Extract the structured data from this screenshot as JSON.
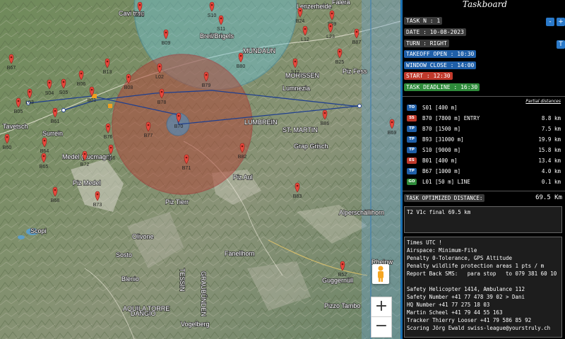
{
  "map": {
    "places": [
      {
        "id": "chur",
        "text": "Cavi trau"
      },
      {
        "id": "breil",
        "text": "Breil/Brigels"
      },
      {
        "id": "lenzerheide",
        "text": "Lenzerheide"
      },
      {
        "id": "falera",
        "text": "Falera"
      },
      {
        "id": "mundaun",
        "text": "MUNDAUN"
      },
      {
        "id": "morissen",
        "text": "MORISSEN"
      },
      {
        "id": "lumnezia",
        "text": "Lumnezia"
      },
      {
        "id": "pizfess",
        "text": "Piz Fess"
      },
      {
        "id": "stmartin",
        "text": "ST. MARTIN"
      },
      {
        "id": "grapgrisch",
        "text": "Grap Grisch"
      },
      {
        "id": "medel",
        "text": "Medel (Lucmagn)"
      },
      {
        "id": "pizmedel",
        "text": "Piz Medel"
      },
      {
        "id": "pizaul",
        "text": "Piz Aul"
      },
      {
        "id": "piztierr",
        "text": "Piz Tierr"
      },
      {
        "id": "alperschall",
        "text": "Alperschällihorn"
      },
      {
        "id": "scopi",
        "text": "Scopi"
      },
      {
        "id": "sosto",
        "text": "Sosto"
      },
      {
        "id": "fanellhorn",
        "text": "Fanellhorn"
      },
      {
        "id": "tessin",
        "text": "TESSIN"
      },
      {
        "id": "graubunden",
        "text": "GRAUBÜNDEN"
      },
      {
        "id": "guggernull",
        "text": "Guggernüll"
      },
      {
        "id": "pizzotambo",
        "text": "Pizzo Tambo"
      },
      {
        "id": "vogelberg",
        "text": "Vogelberg"
      },
      {
        "id": "rheinwald",
        "text": "Rheinw"
      },
      {
        "id": "cavel",
        "text": "Tavetsch"
      },
      {
        "id": "lumbrein",
        "text": "LUMBREIN"
      },
      {
        "id": "surrein",
        "text": "Surrein"
      },
      {
        "id": "olivone",
        "text": "Olivone"
      },
      {
        "id": "blenio",
        "text": "Blenio"
      },
      {
        "id": "aquila",
        "text": "AQUILA TORRE"
      },
      {
        "id": "dangio",
        "text": "DANGIO"
      }
    ],
    "waypoints": [
      {
        "id": "B10",
        "label": "B10"
      },
      {
        "id": "S11",
        "label": "S11"
      },
      {
        "id": "S10",
        "label": "S10"
      },
      {
        "id": "B24",
        "label": "B24"
      },
      {
        "id": "S09",
        "label": "S09"
      },
      {
        "id": "L12",
        "label": "L12"
      },
      {
        "id": "L23",
        "label": "L23"
      },
      {
        "id": "B87",
        "label": "B87"
      },
      {
        "id": "B09",
        "label": "B09"
      },
      {
        "id": "B80",
        "label": "B80"
      },
      {
        "id": "S12",
        "label": "S12"
      },
      {
        "id": "B25",
        "label": "B25"
      },
      {
        "id": "B67",
        "label": "B67"
      },
      {
        "id": "B13",
        "label": "B13"
      },
      {
        "id": "L02",
        "label": "L02"
      },
      {
        "id": "B08",
        "label": "B08"
      },
      {
        "id": "B79",
        "label": "B79"
      },
      {
        "id": "B78",
        "label": "B78"
      },
      {
        "id": "S04",
        "label": "S04"
      },
      {
        "id": "S05",
        "label": "S05"
      },
      {
        "id": "B06",
        "label": "B06"
      },
      {
        "id": "B01",
        "label": "B01"
      },
      {
        "id": "L03",
        "label": "L03"
      },
      {
        "id": "B05",
        "label": "B05"
      },
      {
        "id": "B61",
        "label": "B61"
      },
      {
        "id": "B70",
        "label": "B70"
      },
      {
        "id": "B77",
        "label": "B77"
      },
      {
        "id": "B76",
        "label": "B76"
      },
      {
        "id": "B86",
        "label": "B86"
      },
      {
        "id": "B82",
        "label": "B82"
      },
      {
        "id": "B71",
        "label": "B71"
      },
      {
        "id": "B64",
        "label": "B64"
      },
      {
        "id": "B65",
        "label": "B65"
      },
      {
        "id": "B72",
        "label": "B72"
      },
      {
        "id": "B66",
        "label": "B66"
      },
      {
        "id": "B68",
        "label": "B68"
      },
      {
        "id": "B73",
        "label": "B73"
      },
      {
        "id": "B83",
        "label": "B83"
      },
      {
        "id": "B52",
        "label": "B52"
      },
      {
        "id": "B60",
        "label": "B60"
      },
      {
        "id": "B69",
        "label": "B69"
      }
    ],
    "zoom_in": "+",
    "zoom_out": "−"
  },
  "panel": {
    "title": "Taskboard",
    "task": "TASK N : 1",
    "date": "DATE : 10-08-2023",
    "turn": "TURN : RIGHT",
    "takeoff": "TAKEOFF OPEN : 10:30",
    "window_close": "WINDOW CLOSE : 14:00",
    "start": "START : 12:30",
    "deadline": "TASK DEADLINE : 16:30",
    "btn_minus": "-",
    "btn_plus": "+",
    "btn_t": "T",
    "partial_label": "Partial distances",
    "turnpoints": [
      {
        "type": "TO",
        "color": "#1f5fa8",
        "desc": "S01 [400 m]",
        "dist": ""
      },
      {
        "type": "SS",
        "color": "#c0392b",
        "desc": "B70 [7800 m] ENTRY",
        "dist": "8.8 km"
      },
      {
        "type": "TP",
        "color": "#1f5fa8",
        "desc": "B70 [1500 m]",
        "dist": "7.5 km"
      },
      {
        "type": "TP",
        "color": "#1f5fa8",
        "desc": "B93 [31000 m]",
        "dist": "19.9 km"
      },
      {
        "type": "TP",
        "color": "#1f5fa8",
        "desc": "S10 [9000 m]",
        "dist": "15.8 km"
      },
      {
        "type": "ES",
        "color": "#c0392b",
        "desc": "B01 [400 m]",
        "dist": "13.4 km"
      },
      {
        "type": "TP",
        "color": "#1f5fa8",
        "desc": "B67 [1000 m]",
        "dist": "4.0 km"
      },
      {
        "type": "GO",
        "color": "#2e8b3a",
        "desc": "L01 [50 m] LINE",
        "dist": "0.1 km"
      }
    ],
    "optimized_label": "TASK OPTIMIZED DISTANCE:",
    "optimized_value": "69.5 Km",
    "note": "T2 V1c final 69.5 km",
    "info_lines": [
      "Times UTC !",
      "Airspace: Minimum-File",
      "Penalty 0-Tolerance, GPS Altitude",
      "Penalty wildlife protection areas 1 pts / m",
      "Report Back SMS:   para stop   to 079 381 60 10",
      "",
      "Safety Helicopter 1414, Ambulance 112",
      "Safety Number +41 77 478 39 02 > Dani",
      "HQ Number +41 77 275 18 03",
      "Martin Scheel +41 79 44 55 163",
      "Tracker Thierry Looser +41 79 586 85 92",
      "Scoring Jörg Ewald swiss-league@yourstruly.ch"
    ]
  }
}
